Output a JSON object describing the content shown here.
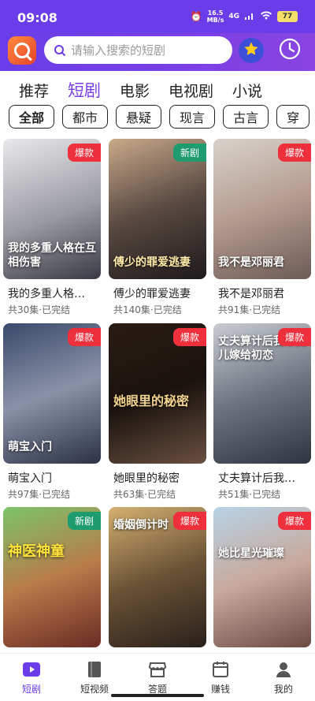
{
  "status": {
    "time": "09:08",
    "speed_value": "16.5",
    "speed_unit": "MB/s",
    "network": "4G",
    "battery": "77"
  },
  "search": {
    "placeholder": "请输入搜索的短剧"
  },
  "tabs": [
    {
      "label": "推荐"
    },
    {
      "label": "短剧"
    },
    {
      "label": "电影"
    },
    {
      "label": "电视剧"
    },
    {
      "label": "小说"
    }
  ],
  "categories": [
    {
      "label": "全部"
    },
    {
      "label": "都市"
    },
    {
      "label": "悬疑"
    },
    {
      "label": "现言"
    },
    {
      "label": "古言"
    },
    {
      "label": "穿"
    }
  ],
  "cards": [
    {
      "title": "我的多重人格…",
      "meta": "共30集·已完结",
      "badge": "爆款",
      "poster_text": "我的多重人格在互相伤害"
    },
    {
      "title": "傅少的罪爱逃妻",
      "meta": "共140集·已完结",
      "badge": "新剧",
      "poster_text": "傅少的罪爱逃妻"
    },
    {
      "title": "我不是邓丽君",
      "meta": "共91集·已完结",
      "badge": "爆款",
      "poster_text": "我不是邓丽君"
    },
    {
      "title": "萌宝入门",
      "meta": "共97集·已完结",
      "badge": "爆款",
      "poster_text": "萌宝入门"
    },
    {
      "title": "她眼里的秘密",
      "meta": "共63集·已完结",
      "badge": "爆款",
      "poster_text": "她眼里的秘密"
    },
    {
      "title": "丈夫算计后我…",
      "meta": "共51集·已完结",
      "badge": "爆款",
      "poster_text": "丈夫算计后我带女儿嫁给初恋"
    },
    {
      "title": "",
      "meta": "",
      "badge": "新剧",
      "poster_text": "神医神童"
    },
    {
      "title": "",
      "meta": "",
      "badge": "爆款",
      "poster_text": "婚姻倒计时"
    },
    {
      "title": "",
      "meta": "",
      "badge": "爆款",
      "poster_text": "她比星光璀璨"
    }
  ],
  "nav": [
    {
      "label": "短剧",
      "icon": "play-icon"
    },
    {
      "label": "短视频",
      "icon": "book-icon"
    },
    {
      "label": "答题",
      "icon": "store-icon"
    },
    {
      "label": "赚钱",
      "icon": "calendar-icon"
    },
    {
      "label": "我的",
      "icon": "user-icon"
    }
  ],
  "colors": {
    "accent": "#6a3de8",
    "hot_badge": "#ee2f3c",
    "new_badge": "#1f9c6f"
  }
}
